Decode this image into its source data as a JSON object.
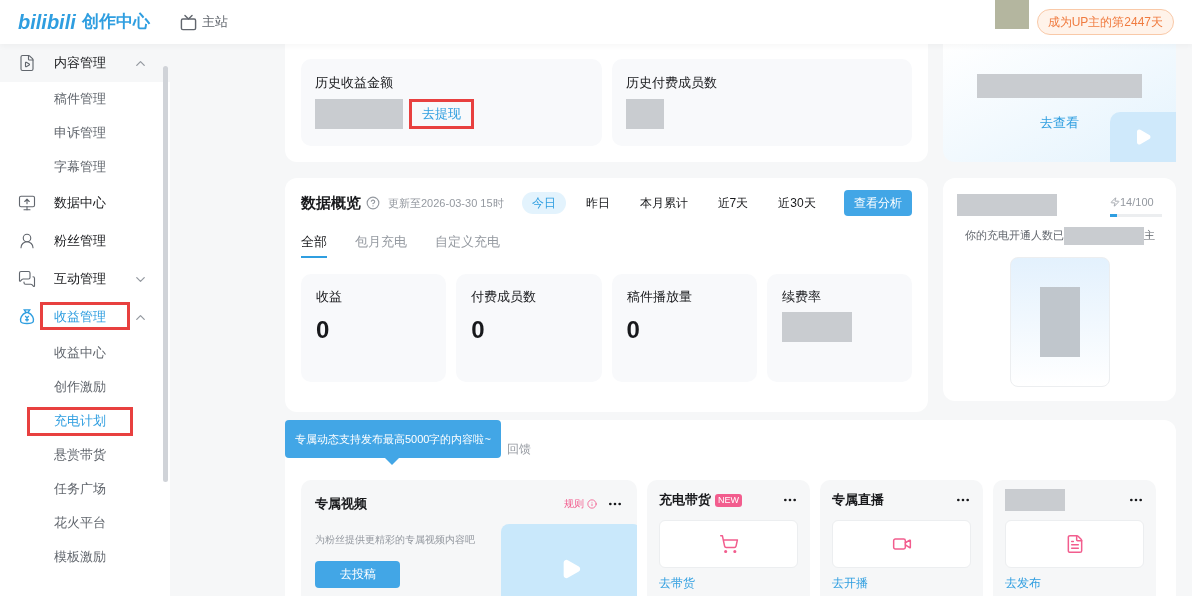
{
  "header": {
    "logo": "bilibili",
    "title": "创作中心",
    "nav": "主站",
    "badge": "成为UP主的第2447天"
  },
  "sidebar": {
    "items": [
      {
        "label": "内容管理",
        "expanded": true,
        "selected": false,
        "children": [
          {
            "label": "稿件管理",
            "selected": false
          },
          {
            "label": "申诉管理",
            "selected": false
          },
          {
            "label": "字幕管理",
            "selected": false
          }
        ]
      },
      {
        "label": "数据中心",
        "selected": false
      },
      {
        "label": "粉丝管理",
        "selected": false
      },
      {
        "label": "互动管理",
        "expanded": false,
        "selected": false
      },
      {
        "label": "收益管理",
        "expanded": true,
        "selected": true,
        "highlighted": true,
        "children": [
          {
            "label": "收益中心",
            "selected": false
          },
          {
            "label": "创作激励",
            "selected": false
          },
          {
            "label": "充电计划",
            "selected": true,
            "highlighted": true
          },
          {
            "label": "悬赏带货",
            "selected": false
          },
          {
            "label": "任务广场",
            "selected": false
          },
          {
            "label": "花火平台",
            "selected": false
          },
          {
            "label": "模板激励",
            "selected": false
          }
        ]
      }
    ]
  },
  "history": [
    {
      "label": "历史收益金额",
      "action": "去提现",
      "highlighted": true
    },
    {
      "label": "历史付费成员数"
    }
  ],
  "promo": {
    "link": "去查看"
  },
  "overview": {
    "title": "数据概览",
    "updated": "更新至2026-03-30 15时",
    "periods": [
      {
        "label": "今日",
        "selected": true
      },
      {
        "label": "昨日",
        "selected": false
      },
      {
        "label": "本月累计",
        "selected": false
      },
      {
        "label": "近7天",
        "selected": false
      },
      {
        "label": "近30天",
        "selected": false
      }
    ],
    "button": "查看分析",
    "tabs": [
      {
        "label": "全部",
        "selected": true
      },
      {
        "label": "包月充电",
        "selected": false
      },
      {
        "label": "自定义充电",
        "selected": false
      }
    ],
    "metrics": [
      {
        "label": "收益",
        "value": "0"
      },
      {
        "label": "付费成员数",
        "value": "0"
      },
      {
        "label": "稿件播放量",
        "value": "0"
      },
      {
        "label": "续费率"
      }
    ]
  },
  "rank": {
    "progress": "14/100",
    "level": 0.14,
    "text_start": "你的充电开通人数已",
    "text_end": "主"
  },
  "tooltip": "专属动态支持发布最高5000字的内容啦~",
  "section_tail": "回馈",
  "features": [
    {
      "kind": "video",
      "title": "专属视频",
      "rules": "规则",
      "desc": "为粉丝提供更精彩的专属视频内容吧",
      "button": "去投稿"
    },
    {
      "kind": "cart",
      "title": "充电带货",
      "badge": "NEW",
      "link": "去带货"
    },
    {
      "kind": "live",
      "title": "专属直播",
      "link": "去开播"
    },
    {
      "kind": "post",
      "link": "去发布"
    }
  ]
}
